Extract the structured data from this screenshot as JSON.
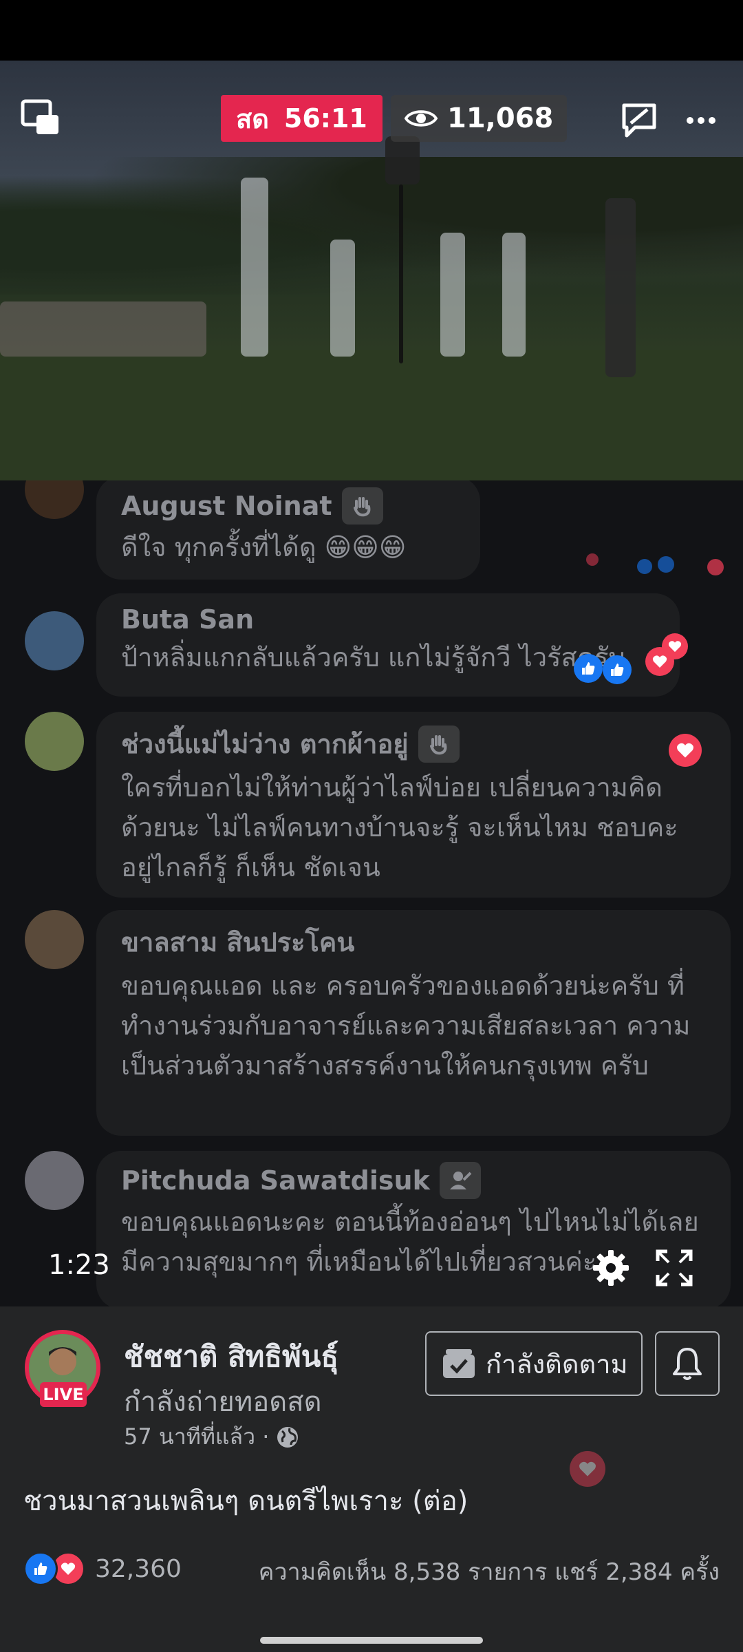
{
  "video": {
    "live_label": "สด",
    "live_time": "56:11",
    "viewers": "11,068",
    "elapsed": "1:23"
  },
  "comments": [
    {
      "name": "August Noinat",
      "text": "ดีใจ ทุกครั้งที่ได้ดู 😁😁😁",
      "badge": "waving-hand-icon"
    },
    {
      "name": "Buta San",
      "text": "ป้าหลิ่มแกกลับแล้วครับ แกไม่รู้จักวี ไวรัสครับ"
    },
    {
      "name": "ช่วงนี้แม่ไม่ว่าง ตากผ้าอยู่",
      "text": "ใครที่บอกไม่ให้ท่านผู้ว่าไลฟ์บ่อย เปลี่ยนความคิดด้วยนะ ไม่ไลฟ์คนทางบ้านจะรู้ จะเห็นไหม ชอบคะ อยู่ไกลก็รู้ ก็เห็น ชัดเจน",
      "badge": "waving-hand-icon"
    },
    {
      "name": "ขาลสาม สินประโคน",
      "text": "ขอบคุณแอด และ ครอบครัวของแอดด้วยน่ะครับ ที่ทำงานร่วมกับอาจารย์และความเสียสละเวลา ความเป็นส่วนตัวมาสร้างสรรค์งานให้คนกรุงเทพ ครับ"
    },
    {
      "name": "Pitchuda Sawatdisuk",
      "text": "ขอบคุณแอดนะคะ ตอนนี้ท้องอ่อนๆ ไปไหนไม่ได้เลย มีความสุขมากๆ ที่เหมือนได้ไปเที่ยวสวนค่ะ",
      "badge": "new-member-icon"
    }
  ],
  "page": {
    "name": "ชัชชาติ สิทธิพันธุ์",
    "status": "กำลังถ่ายทอดสด",
    "time": "57 นาทีที่แล้ว ·",
    "live_tag": "LIVE",
    "follow_label": "กำลังติดตาม"
  },
  "post": {
    "description": "ชวนมาสวนเพลินๆ ดนตรีไพเราะ (ต่อ)",
    "reaction_count": "32,360",
    "stats": "ความคิดเห็น 8,538 รายการ แชร์ 2,384 ครั้ง"
  },
  "colors": {
    "live_red": "#e4264f",
    "like_blue": "#1877f2",
    "heart_red": "#f33e58"
  }
}
